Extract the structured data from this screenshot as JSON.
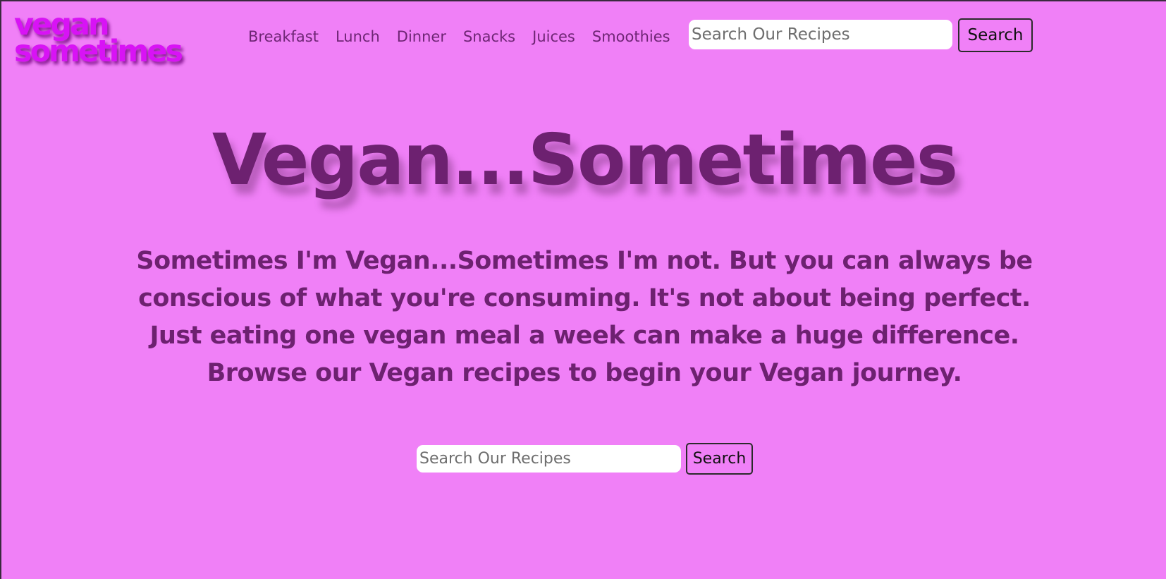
{
  "header": {
    "logo": {
      "line1": "vegan",
      "line2": "sometimes"
    },
    "nav": [
      {
        "label": "Breakfast"
      },
      {
        "label": "Lunch"
      },
      {
        "label": "Dinner"
      },
      {
        "label": "Snacks"
      },
      {
        "label": "Juices"
      },
      {
        "label": "Smoothies"
      }
    ],
    "search": {
      "placeholder": "Search Our Recipes",
      "value": "",
      "button_label": "Search"
    }
  },
  "hero": {
    "title": "Vegan...Sometimes",
    "subtitle": "Sometimes I'm Vegan...Sometimes I'm not. But you can always be conscious of what you're consuming. It's not about being perfect. Just eating one vegan meal a week can make a huge difference. Browse our Vegan recipes to begin your Vegan journey.",
    "search": {
      "placeholder": "Search Our Recipes",
      "value": "",
      "button_label": "Search"
    }
  },
  "colors": {
    "background": "#f080f7",
    "logo": "#d813f5",
    "text": "#6d2170",
    "nav_text": "#6e2574"
  }
}
